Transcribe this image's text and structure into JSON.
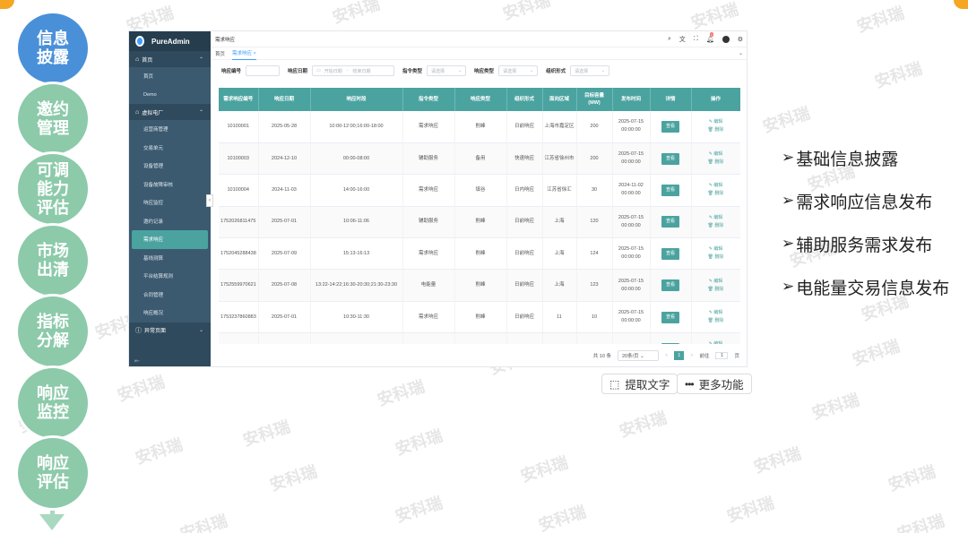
{
  "watermark_text": "安科瑞",
  "steps": [
    {
      "label": "信息披露",
      "active": true
    },
    {
      "label": "邀约管理",
      "active": false
    },
    {
      "label": "可调能力评估",
      "active": false
    },
    {
      "label": "市场出清",
      "active": false
    },
    {
      "label": "指标分解",
      "active": false
    },
    {
      "label": "响应监控",
      "active": false
    },
    {
      "label": "响应评估",
      "active": false
    }
  ],
  "app": {
    "brand": "PureAdmin",
    "breadcrumb": "需求响应",
    "tabs": [
      "首页",
      "需求响应"
    ],
    "sidebar": {
      "group1": "首页",
      "group1_items": [
        "首页",
        "Demo"
      ],
      "group2": "虚拟电厂",
      "group2_items": [
        "运营商管理",
        "交易单元",
        "设备管理",
        "设备故障审核",
        "响应监控",
        "邀约记录",
        "需求响应",
        "基线测算",
        "平台结算规则",
        "合同管理",
        "响应概况"
      ],
      "group3": "异常页面"
    },
    "filters": {
      "code_label": "响应编号",
      "date_label": "响应日期",
      "date_start": "开始日期",
      "date_sep": "-",
      "date_end": "结束日期",
      "cmd_label": "指令类型",
      "resp_label": "响应类型",
      "org_label": "组织形式",
      "placeholder": "请选择"
    },
    "table": {
      "columns": [
        "需求响应编号",
        "响应日期",
        "响应时段",
        "指令类型",
        "响应类型",
        "组织形式",
        "面向区域",
        "目标容量(MW)",
        "发布时间",
        "详情",
        "操作"
      ],
      "view_label": "查看",
      "edit_label": "✎ 编辑",
      "delete_label": "🗑 删除",
      "rows": [
        [
          "10100001",
          "2025-05-28",
          "10:00-12:00;16:00-18:00",
          "需求响应",
          "削峰",
          "日前响应",
          "上海市嘉定区",
          "200",
          "2025-07-15 00:00:00"
        ],
        [
          "10100003",
          "2024-12-10",
          "00:00-08:00",
          "辅助服务",
          "备用",
          "快速响应",
          "江苏省徐州市",
          "200",
          "2025-07-15 00:00:00"
        ],
        [
          "10100004",
          "2024-11-03",
          "14:00-16:00",
          "需求响应",
          "填谷",
          "日内响应",
          "江苏省徐汇",
          "30",
          "2024-11-02 00:00:00"
        ],
        [
          "1752026811475",
          "2025-07-01",
          "10:06-11:06",
          "辅助服务",
          "削峰",
          "日前响应",
          "上海",
          "120",
          "2025-07-15 00:00:00"
        ],
        [
          "1752045288438",
          "2025-07-09",
          "15:13-16:13",
          "需求响应",
          "削峰",
          "日前响应",
          "上海",
          "124",
          "2025-07-15 00:00:00"
        ],
        [
          "1752559970621",
          "2025-07-08",
          "13:22-14:22;16:30-20:30;21:30-23:30",
          "电能量",
          "削峰",
          "日前响应",
          "上海",
          "123",
          "2025-07-15 00:00:00"
        ],
        [
          "1753237860883",
          "2025-07-01",
          "10:30-11:30",
          "需求响应",
          "削峰",
          "日前响应",
          "11",
          "10",
          "2025-07-15 00:00:00"
        ],
        [
          "175323820",
          "",
          "",
          "",
          "",
          "",
          "",
          "",
          "2025-07-"
        ]
      ]
    },
    "pager": {
      "total": "共 10 条",
      "size": "20条/页",
      "prev": "<",
      "page": "1",
      "next": ">",
      "goto": "前往",
      "goto_value": "1",
      "page_unit": "页"
    }
  },
  "buttons": {
    "ocr": "提取文字",
    "more": "更多功能"
  },
  "bullets": [
    "基础信息披露",
    "需求响应信息发布",
    "辅助服务需求发布",
    "电能量交易信息发布"
  ]
}
